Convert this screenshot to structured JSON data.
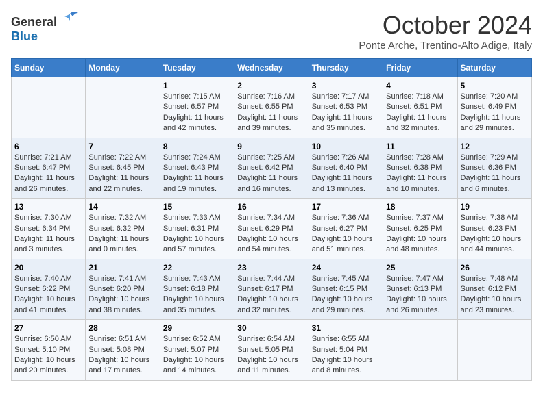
{
  "header": {
    "logo": {
      "general": "General",
      "blue": "Blue"
    },
    "title": "October 2024",
    "subtitle": "Ponte Arche, Trentino-Alto Adige, Italy"
  },
  "calendar": {
    "weekdays": [
      "Sunday",
      "Monday",
      "Tuesday",
      "Wednesday",
      "Thursday",
      "Friday",
      "Saturday"
    ],
    "weeks": [
      [
        {
          "day": "",
          "sunrise": "",
          "sunset": "",
          "daylight": ""
        },
        {
          "day": "",
          "sunrise": "",
          "sunset": "",
          "daylight": ""
        },
        {
          "day": "1",
          "sunrise": "Sunrise: 7:15 AM",
          "sunset": "Sunset: 6:57 PM",
          "daylight": "Daylight: 11 hours and 42 minutes."
        },
        {
          "day": "2",
          "sunrise": "Sunrise: 7:16 AM",
          "sunset": "Sunset: 6:55 PM",
          "daylight": "Daylight: 11 hours and 39 minutes."
        },
        {
          "day": "3",
          "sunrise": "Sunrise: 7:17 AM",
          "sunset": "Sunset: 6:53 PM",
          "daylight": "Daylight: 11 hours and 35 minutes."
        },
        {
          "day": "4",
          "sunrise": "Sunrise: 7:18 AM",
          "sunset": "Sunset: 6:51 PM",
          "daylight": "Daylight: 11 hours and 32 minutes."
        },
        {
          "day": "5",
          "sunrise": "Sunrise: 7:20 AM",
          "sunset": "Sunset: 6:49 PM",
          "daylight": "Daylight: 11 hours and 29 minutes."
        }
      ],
      [
        {
          "day": "6",
          "sunrise": "Sunrise: 7:21 AM",
          "sunset": "Sunset: 6:47 PM",
          "daylight": "Daylight: 11 hours and 26 minutes."
        },
        {
          "day": "7",
          "sunrise": "Sunrise: 7:22 AM",
          "sunset": "Sunset: 6:45 PM",
          "daylight": "Daylight: 11 hours and 22 minutes."
        },
        {
          "day": "8",
          "sunrise": "Sunrise: 7:24 AM",
          "sunset": "Sunset: 6:43 PM",
          "daylight": "Daylight: 11 hours and 19 minutes."
        },
        {
          "day": "9",
          "sunrise": "Sunrise: 7:25 AM",
          "sunset": "Sunset: 6:42 PM",
          "daylight": "Daylight: 11 hours and 16 minutes."
        },
        {
          "day": "10",
          "sunrise": "Sunrise: 7:26 AM",
          "sunset": "Sunset: 6:40 PM",
          "daylight": "Daylight: 11 hours and 13 minutes."
        },
        {
          "day": "11",
          "sunrise": "Sunrise: 7:28 AM",
          "sunset": "Sunset: 6:38 PM",
          "daylight": "Daylight: 11 hours and 10 minutes."
        },
        {
          "day": "12",
          "sunrise": "Sunrise: 7:29 AM",
          "sunset": "Sunset: 6:36 PM",
          "daylight": "Daylight: 11 hours and 6 minutes."
        }
      ],
      [
        {
          "day": "13",
          "sunrise": "Sunrise: 7:30 AM",
          "sunset": "Sunset: 6:34 PM",
          "daylight": "Daylight: 11 hours and 3 minutes."
        },
        {
          "day": "14",
          "sunrise": "Sunrise: 7:32 AM",
          "sunset": "Sunset: 6:32 PM",
          "daylight": "Daylight: 11 hours and 0 minutes."
        },
        {
          "day": "15",
          "sunrise": "Sunrise: 7:33 AM",
          "sunset": "Sunset: 6:31 PM",
          "daylight": "Daylight: 10 hours and 57 minutes."
        },
        {
          "day": "16",
          "sunrise": "Sunrise: 7:34 AM",
          "sunset": "Sunset: 6:29 PM",
          "daylight": "Daylight: 10 hours and 54 minutes."
        },
        {
          "day": "17",
          "sunrise": "Sunrise: 7:36 AM",
          "sunset": "Sunset: 6:27 PM",
          "daylight": "Daylight: 10 hours and 51 minutes."
        },
        {
          "day": "18",
          "sunrise": "Sunrise: 7:37 AM",
          "sunset": "Sunset: 6:25 PM",
          "daylight": "Daylight: 10 hours and 48 minutes."
        },
        {
          "day": "19",
          "sunrise": "Sunrise: 7:38 AM",
          "sunset": "Sunset: 6:23 PM",
          "daylight": "Daylight: 10 hours and 44 minutes."
        }
      ],
      [
        {
          "day": "20",
          "sunrise": "Sunrise: 7:40 AM",
          "sunset": "Sunset: 6:22 PM",
          "daylight": "Daylight: 10 hours and 41 minutes."
        },
        {
          "day": "21",
          "sunrise": "Sunrise: 7:41 AM",
          "sunset": "Sunset: 6:20 PM",
          "daylight": "Daylight: 10 hours and 38 minutes."
        },
        {
          "day": "22",
          "sunrise": "Sunrise: 7:43 AM",
          "sunset": "Sunset: 6:18 PM",
          "daylight": "Daylight: 10 hours and 35 minutes."
        },
        {
          "day": "23",
          "sunrise": "Sunrise: 7:44 AM",
          "sunset": "Sunset: 6:17 PM",
          "daylight": "Daylight: 10 hours and 32 minutes."
        },
        {
          "day": "24",
          "sunrise": "Sunrise: 7:45 AM",
          "sunset": "Sunset: 6:15 PM",
          "daylight": "Daylight: 10 hours and 29 minutes."
        },
        {
          "day": "25",
          "sunrise": "Sunrise: 7:47 AM",
          "sunset": "Sunset: 6:13 PM",
          "daylight": "Daylight: 10 hours and 26 minutes."
        },
        {
          "day": "26",
          "sunrise": "Sunrise: 7:48 AM",
          "sunset": "Sunset: 6:12 PM",
          "daylight": "Daylight: 10 hours and 23 minutes."
        }
      ],
      [
        {
          "day": "27",
          "sunrise": "Sunrise: 6:50 AM",
          "sunset": "Sunset: 5:10 PM",
          "daylight": "Daylight: 10 hours and 20 minutes."
        },
        {
          "day": "28",
          "sunrise": "Sunrise: 6:51 AM",
          "sunset": "Sunset: 5:08 PM",
          "daylight": "Daylight: 10 hours and 17 minutes."
        },
        {
          "day": "29",
          "sunrise": "Sunrise: 6:52 AM",
          "sunset": "Sunset: 5:07 PM",
          "daylight": "Daylight: 10 hours and 14 minutes."
        },
        {
          "day": "30",
          "sunrise": "Sunrise: 6:54 AM",
          "sunset": "Sunset: 5:05 PM",
          "daylight": "Daylight: 10 hours and 11 minutes."
        },
        {
          "day": "31",
          "sunrise": "Sunrise: 6:55 AM",
          "sunset": "Sunset: 5:04 PM",
          "daylight": "Daylight: 10 hours and 8 minutes."
        },
        {
          "day": "",
          "sunrise": "",
          "sunset": "",
          "daylight": ""
        },
        {
          "day": "",
          "sunrise": "",
          "sunset": "",
          "daylight": ""
        }
      ]
    ]
  }
}
